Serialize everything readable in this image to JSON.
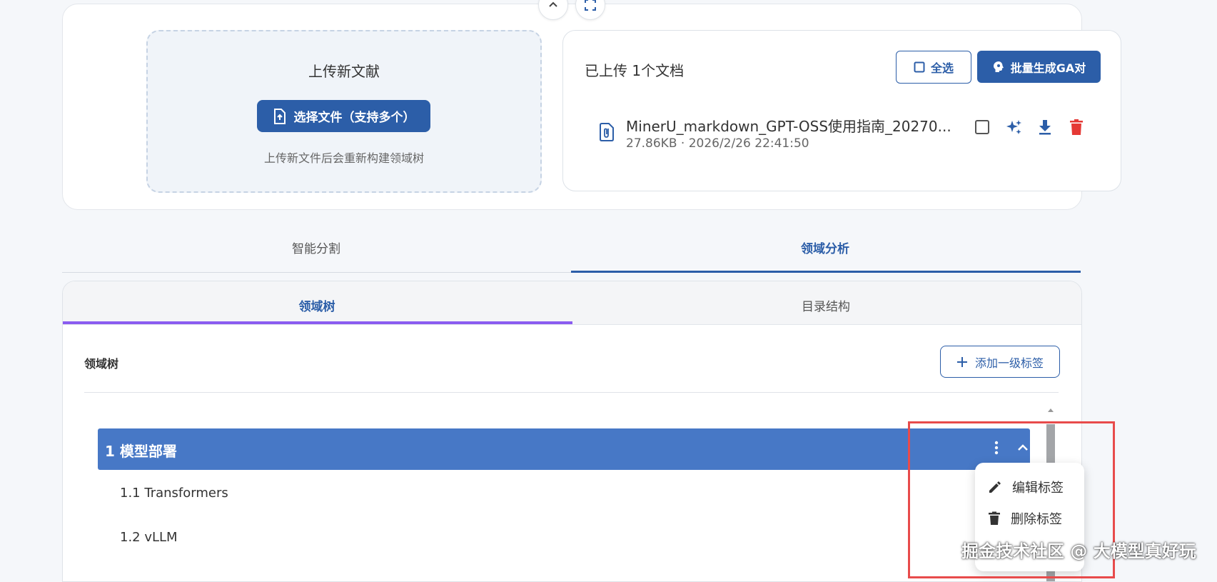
{
  "upload": {
    "title": "上传新文献",
    "select_button": "选择文件（支持多个）",
    "hint": "上传新文件后会重新构建领域树"
  },
  "documents": {
    "count_label": "已上传 1个文档",
    "select_all": "全选",
    "batch_generate": "批量生成GA对",
    "items": [
      {
        "name": "MinerU_markdown_GPT-OSS使用指南_20270...",
        "meta": "27.86KB · 2026/2/26 22:41:50"
      }
    ]
  },
  "main_tabs": [
    {
      "label": "智能分割",
      "active": false
    },
    {
      "label": "领域分析",
      "active": true
    }
  ],
  "sub_tabs": [
    {
      "label": "领域树",
      "active": true
    },
    {
      "label": "目录结构",
      "active": false
    }
  ],
  "tree": {
    "section_label": "领域树",
    "add_button": "添加一级标签",
    "root": {
      "label": "1 模型部署"
    },
    "children": [
      {
        "label": "1.1 Transformers"
      },
      {
        "label": "1.2 vLLM"
      }
    ]
  },
  "context_menu": {
    "items": [
      {
        "label": "编辑标签",
        "icon": "pencil-icon"
      },
      {
        "label": "删除标签",
        "icon": "trash-icon"
      }
    ]
  },
  "watermark": "掘金技术社区 @ 大模型真好玩",
  "colors": {
    "primary": "#2c5ea8",
    "tree_root_bg": "#4778c6",
    "subtab_indicator": "#8a5cf0",
    "delete": "#e53935",
    "highlight": "#e84b4b"
  }
}
